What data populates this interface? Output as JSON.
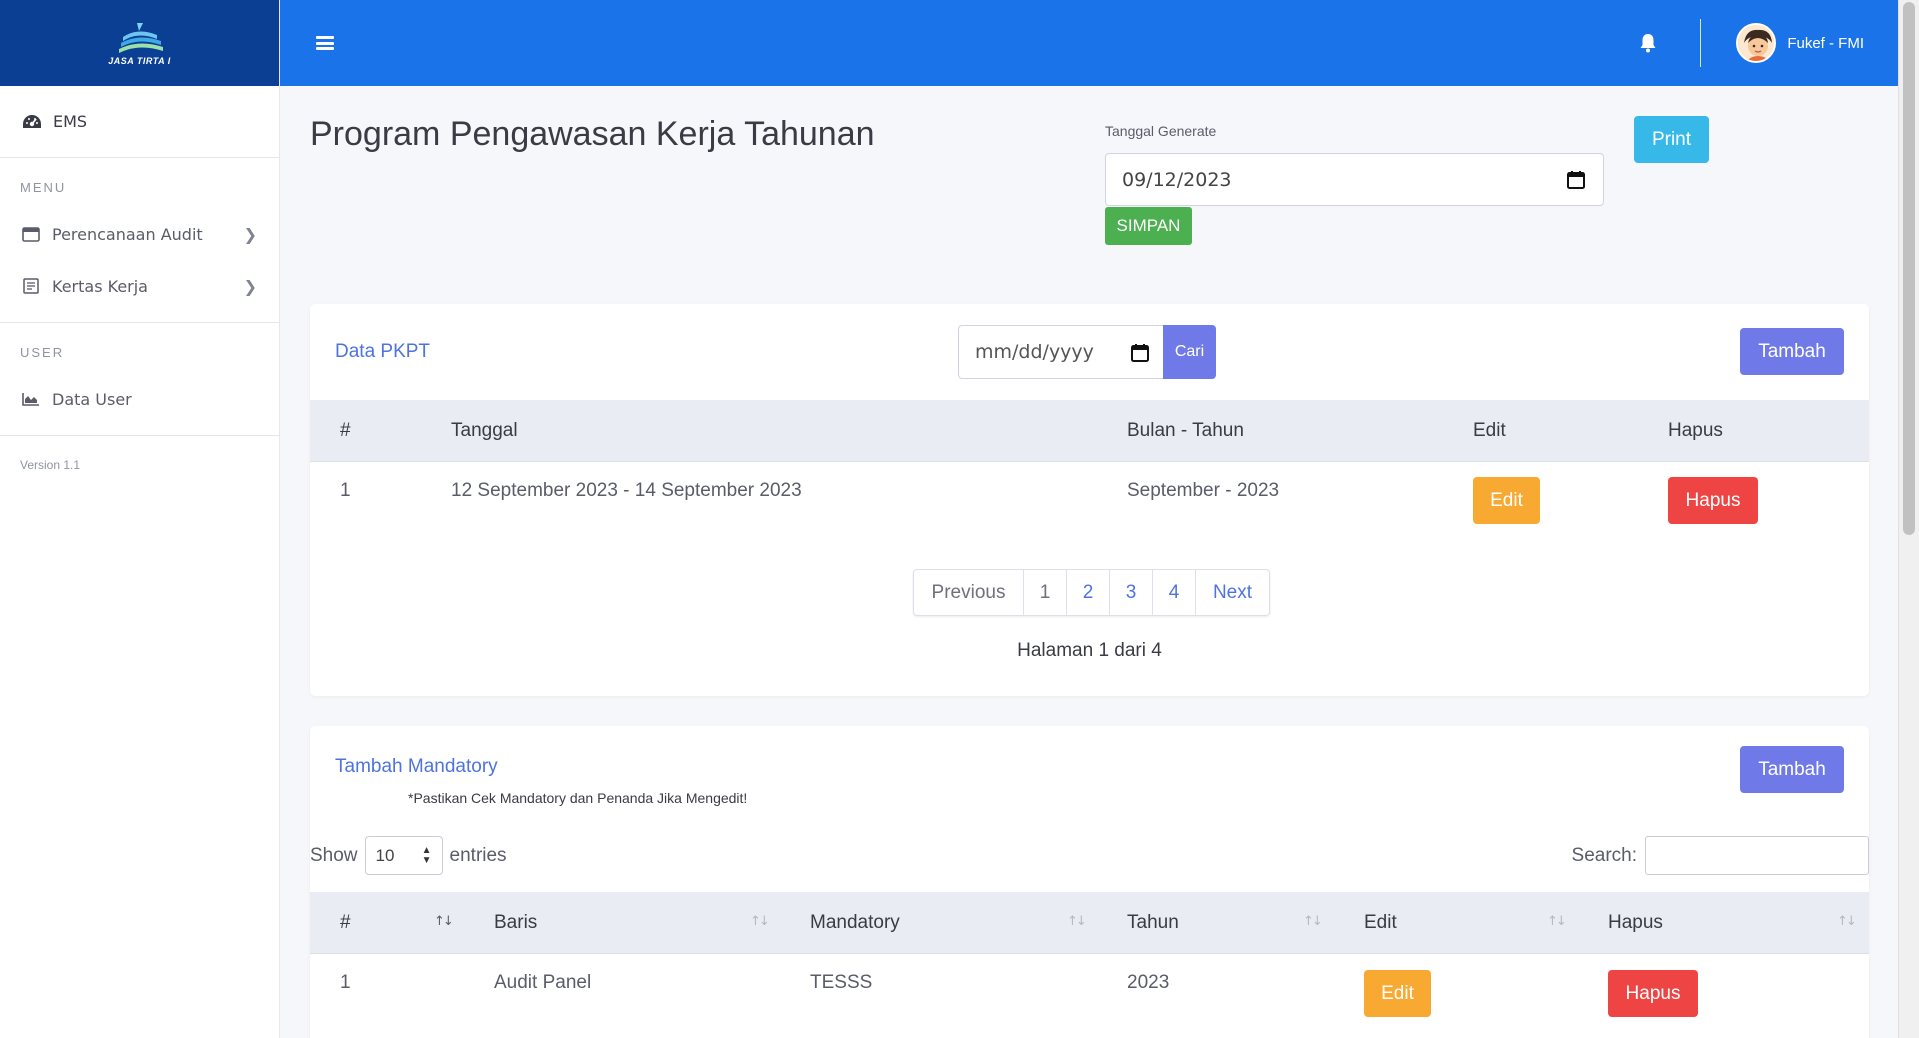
{
  "brand": {
    "logo_text": "JASA TIRTA I"
  },
  "sidebar": {
    "ems_label": "EMS",
    "menu_heading": "MENU",
    "menu_items": [
      {
        "label": "Perencanaan Audit",
        "icon": "calendar-icon"
      },
      {
        "label": "Kertas Kerja",
        "icon": "document-icon"
      }
    ],
    "user_heading": "USER",
    "user_items": [
      {
        "label": "Data User",
        "icon": "chart-icon"
      }
    ],
    "version": "Version 1.1"
  },
  "topbar": {
    "username": "Fukef - FMI",
    "icons": [
      "hamburger-icon",
      "bell-icon",
      "avatar"
    ]
  },
  "page": {
    "title": "Program Pengawasan Kerja Tahunan",
    "generate_label": "Tanggal Generate",
    "generate_date": "09/12/2023",
    "simpan_label": "SIMPAN",
    "print_label": "Print"
  },
  "pkpt": {
    "title": "Data PKPT",
    "date_placeholder": "mm/dd/yyyy",
    "cari_label": "Cari",
    "tambah_label": "Tambah",
    "columns": [
      "#",
      "Tanggal",
      "Bulan - Tahun",
      "Edit",
      "Hapus"
    ],
    "rows": [
      {
        "no": "1",
        "tanggal": "12 September 2023 - 14 September 2023",
        "bulan_tahun": "September - 2023",
        "edit": "Edit",
        "hapus": "Hapus"
      }
    ],
    "pagination": {
      "previous": "Previous",
      "pages": [
        "1",
        "2",
        "3",
        "4"
      ],
      "next": "Next",
      "current_page": 1
    },
    "page_info": "Halaman 1 dari 4"
  },
  "mandatory": {
    "title": "Tambah Mandatory",
    "note": "*Pastikan Cek Mandatory dan Penanda Jika Mengedit!",
    "tambah_label": "Tambah",
    "show_label": "Show",
    "entries_value": "10",
    "entries_label": "entries",
    "search_label": "Search:",
    "columns": [
      "#",
      "Baris",
      "Mandatory",
      "Tahun",
      "Edit",
      "Hapus"
    ],
    "rows": [
      {
        "no": "1",
        "baris": "Audit Panel",
        "mandatory": "TESSS",
        "tahun": "2023",
        "edit": "Edit",
        "hapus": "Hapus"
      }
    ]
  },
  "colors": {
    "topbar": "#1a73e8",
    "brand": "#0a3f94",
    "primary_button": "#6f7ae8",
    "print_button": "#36b9e9",
    "simpan_button": "#4caf50",
    "edit_button": "#f8a932",
    "hapus_button": "#ef4444"
  }
}
